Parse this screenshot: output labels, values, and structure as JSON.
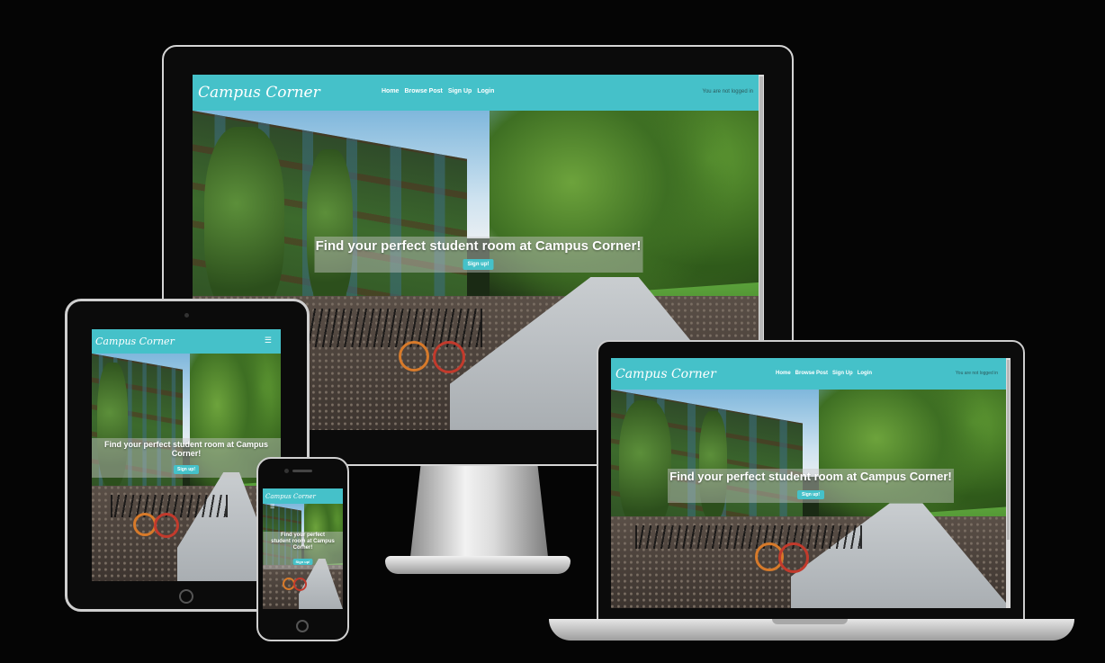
{
  "site": {
    "brand": "Campus Corner",
    "nav": {
      "home": "Home",
      "browse": "Browse Post",
      "signup": "Sign Up",
      "login": "Login"
    },
    "login_status": "You are not logged in",
    "hero": {
      "headline": "Find your perfect student room at Campus Corner!",
      "tablet_line1": "Find your perfect student room at Campus",
      "tablet_line2": "Corner!",
      "phone_line1": "Find your perfect",
      "phone_line2": "student room at Campus",
      "phone_line3": "Corner!",
      "cta": "Sign up!"
    }
  },
  "icons": {
    "menu": "hamburger-icon"
  },
  "colors": {
    "accent": "#45c1c9",
    "background": "#050505"
  }
}
